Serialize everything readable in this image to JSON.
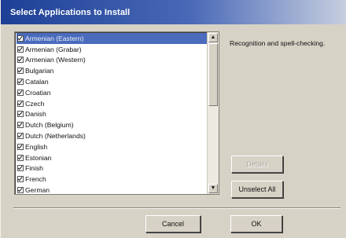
{
  "window": {
    "title": "Select Applications to Install"
  },
  "list": {
    "items": [
      {
        "label": "Armenian (Eastern)",
        "checked": true,
        "selected": true
      },
      {
        "label": "Armenian (Grabar)",
        "checked": true
      },
      {
        "label": "Armenian (Western)",
        "checked": true
      },
      {
        "label": "Bulgarian",
        "checked": true
      },
      {
        "label": "Catalan",
        "checked": true
      },
      {
        "label": "Croatian",
        "checked": true
      },
      {
        "label": "Czech",
        "checked": true
      },
      {
        "label": "Danish",
        "checked": true
      },
      {
        "label": "Dutch (Belgium)",
        "checked": true
      },
      {
        "label": "Dutch (Netherlands)",
        "checked": true
      },
      {
        "label": "English",
        "checked": true
      },
      {
        "label": "Estonian",
        "checked": true
      },
      {
        "label": "Finish",
        "checked": true
      },
      {
        "label": "French",
        "checked": true
      },
      {
        "label": "German",
        "checked": true
      }
    ]
  },
  "description": "Recognition and spell-checking.",
  "buttons": {
    "details": "Details",
    "unselect_all": "Unselect All",
    "cancel": "Cancel",
    "ok": "OK"
  },
  "scrollbar": {
    "up_glyph": "▲",
    "down_glyph": "▼"
  }
}
